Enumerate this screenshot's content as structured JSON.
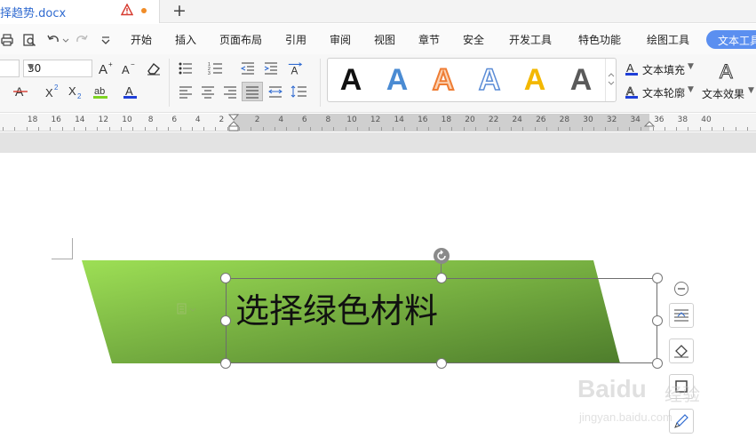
{
  "tab": {
    "doc_name": "择趋势.docx",
    "new_tab_symbol": "+"
  },
  "menu": {
    "items": [
      "开始",
      "插入",
      "页面布局",
      "引用",
      "审阅",
      "视图",
      "章节",
      "安全",
      "开发工具",
      "特色功能",
      "绘图工具"
    ],
    "active": "文本工具"
  },
  "ribbon": {
    "font_size": "30",
    "text_fill_label": "文本填充",
    "text_outline_label": "文本轮廓",
    "text_effect_label": "文本效果",
    "gallery_glyph": "A",
    "gallery_colors": [
      "#111111",
      "#4a8bd3",
      "#ef7d34",
      "#5b8cd6",
      "#f3b800",
      "#5a5a5a"
    ]
  },
  "ruler": {
    "left_numbers": [
      "18",
      "16",
      "14",
      "12",
      "10",
      "8",
      "6",
      "4",
      "2"
    ],
    "right_numbers": [
      "2",
      "4",
      "6",
      "8",
      "10",
      "12",
      "14",
      "16",
      "18",
      "20",
      "22",
      "24",
      "26",
      "28",
      "30",
      "32",
      "34",
      "36",
      "38",
      "40"
    ]
  },
  "document": {
    "textbox_text": "选择绿色材料",
    "shape_gradient": [
      "#9ddf55",
      "#4e7d2c"
    ]
  },
  "watermark": {
    "brand": "Baidu",
    "suffix": "经验",
    "url": "jingyan.baidu.com"
  },
  "colors": {
    "accent": "#5b8ff0",
    "tab_text": "#2f6ad0",
    "warn": "#d63a2f"
  }
}
